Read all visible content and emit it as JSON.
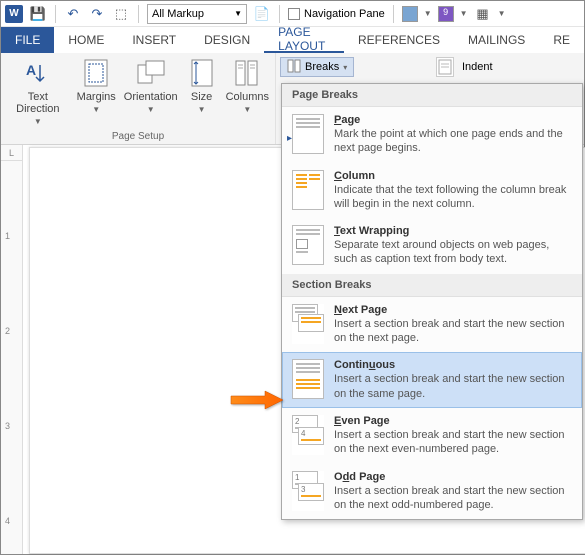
{
  "qat": {
    "app_badge": "W",
    "markup_combo": "All Markup",
    "nav_pane_label": "Navigation Pane"
  },
  "tabs": {
    "file": "FILE",
    "home": "HOME",
    "insert": "INSERT",
    "design": "DESIGN",
    "page_layout": "PAGE LAYOUT",
    "references": "REFERENCES",
    "mailings": "MAILINGS",
    "review": "RE"
  },
  "ribbon": {
    "text_direction": "Text Direction",
    "margins": "Margins",
    "orientation": "Orientation",
    "size": "Size",
    "columns": "Columns",
    "group_label": "Page Setup",
    "breaks": "Breaks",
    "indent": "Indent"
  },
  "dropdown": {
    "page_breaks_header": "Page Breaks",
    "section_breaks_header": "Section Breaks",
    "items": [
      {
        "title": "Page",
        "u": "P",
        "rest": "age",
        "desc": "Mark the point at which one page ends and the next page begins."
      },
      {
        "title": "Column",
        "u": "C",
        "rest": "olumn",
        "desc": "Indicate that the text following the column break will begin in the next column."
      },
      {
        "title": "Text Wrapping",
        "u": "T",
        "rest": "ext Wrapping",
        "desc": "Separate text around objects on web pages, such as caption text from body text."
      },
      {
        "title": "Next Page",
        "u": "N",
        "rest": "ext Page",
        "desc": "Insert a section break and start the new section on the next page."
      },
      {
        "title": "Continuous",
        "u": "",
        "rest": "Continuous",
        "pre": "Contin",
        "uchar": "u",
        "suf": "ous",
        "desc": "Insert a section break and start the new section on the same page."
      },
      {
        "title": "Even Page",
        "u": "E",
        "rest": "ven Page",
        "desc": "Insert a section break and start the new section on the next even-numbered page."
      },
      {
        "title": "Odd Page",
        "u": "",
        "rest": "",
        "pre": "O",
        "uchar": "d",
        "suf": "d Page",
        "desc": "Insert a section break and start the new section on the next odd-numbered page."
      }
    ]
  },
  "ruler": {
    "marks": [
      "1",
      "2",
      "3",
      "4"
    ]
  }
}
